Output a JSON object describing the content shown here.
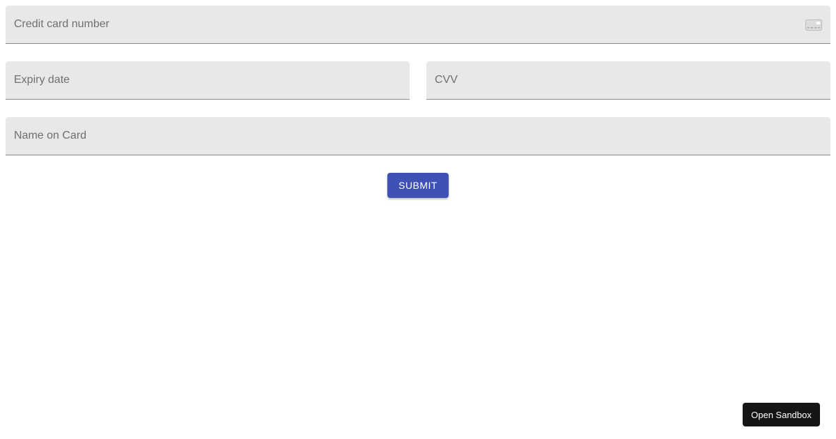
{
  "form": {
    "card_number": {
      "placeholder": "Credit card number",
      "value": "",
      "icon": "credit-card-icon"
    },
    "expiry": {
      "placeholder": "Expiry date",
      "value": ""
    },
    "cvv": {
      "placeholder": "CVV",
      "value": ""
    },
    "name": {
      "placeholder": "Name on Card",
      "value": ""
    },
    "submit_label": "SUBMIT"
  },
  "sandbox": {
    "label": "Open Sandbox"
  },
  "colors": {
    "primary": "#3f51b5",
    "field_background": "#e8e8e8",
    "placeholder_text": "#6f6f6f",
    "sandbox_background": "#151515"
  }
}
